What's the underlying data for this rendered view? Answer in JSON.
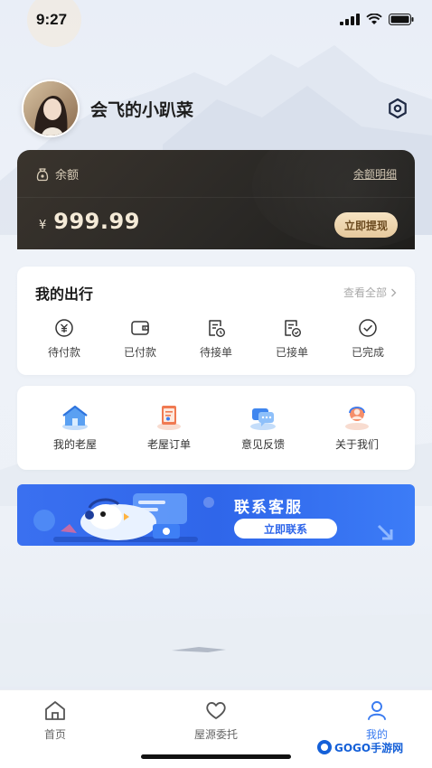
{
  "status_bar": {
    "time": "9:27"
  },
  "profile": {
    "username": "会飞的小趴菜"
  },
  "balance": {
    "label": "余额",
    "detail_link": "余额明细",
    "currency": "¥",
    "amount": "999.99",
    "withdraw_label": "立即提现"
  },
  "trips": {
    "title": "我的出行",
    "view_all": "查看全部",
    "items": [
      {
        "label": "待付款",
        "icon": "pending-payment-icon"
      },
      {
        "label": "已付款",
        "icon": "paid-icon"
      },
      {
        "label": "待接单",
        "icon": "awaiting-order-icon"
      },
      {
        "label": "已接单",
        "icon": "accepted-order-icon"
      },
      {
        "label": "已完成",
        "icon": "completed-icon"
      }
    ]
  },
  "services": {
    "items": [
      {
        "label": "我的老屋",
        "icon": "house-icon"
      },
      {
        "label": "老屋订单",
        "icon": "order-icon"
      },
      {
        "label": "意见反馈",
        "icon": "feedback-icon"
      },
      {
        "label": "关于我们",
        "icon": "about-icon"
      }
    ]
  },
  "banner": {
    "title": "联系客服",
    "button": "立即联系"
  },
  "tabbar": {
    "tabs": [
      {
        "label": "首页",
        "icon": "home-icon"
      },
      {
        "label": "屋源委托",
        "icon": "heart-icon"
      },
      {
        "label": "我的",
        "icon": "user-icon",
        "active": true
      }
    ]
  },
  "watermark": {
    "text": "GOGO手游网"
  },
  "colors": {
    "accent": "#3a7bf0",
    "banner": "#2f66ea",
    "card_dark": "#2b2926",
    "gold": "#e6c99d"
  }
}
